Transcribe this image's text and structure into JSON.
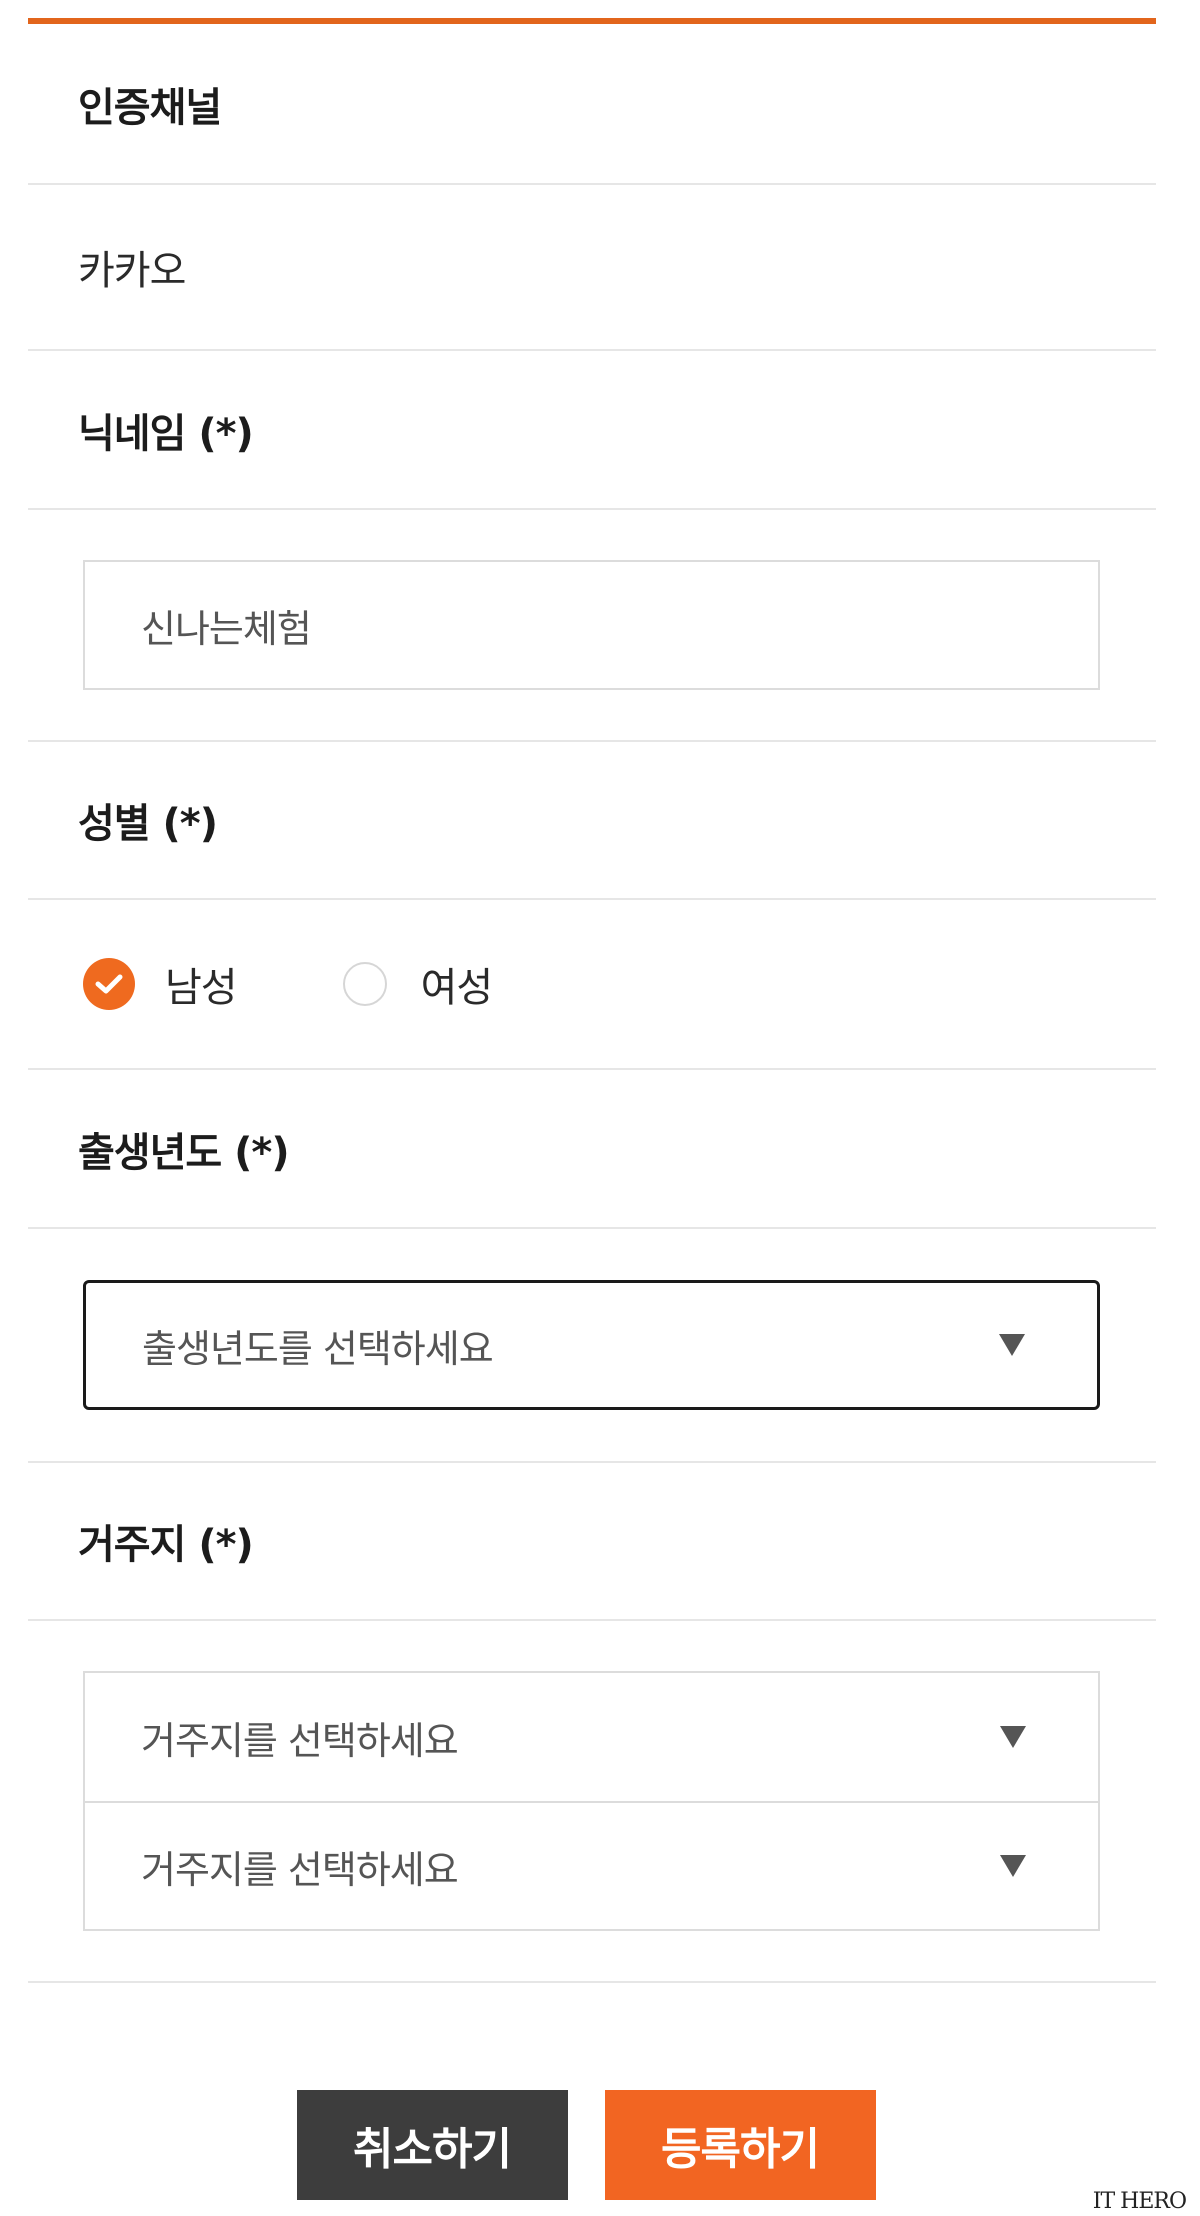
{
  "auth_channel": {
    "label": "인증채널",
    "value": "카카오"
  },
  "nickname": {
    "label": "닉네임 (*)",
    "value": "신나는체험"
  },
  "gender": {
    "label": "성별 (*)",
    "options": [
      {
        "label": "남성",
        "selected": true
      },
      {
        "label": "여성",
        "selected": false
      }
    ]
  },
  "birth_year": {
    "label": "출생년도 (*)",
    "placeholder": "출생년도를 선택하세요"
  },
  "residence": {
    "label": "거주지 (*)",
    "select1_placeholder": "거주지를 선택하세요",
    "select2_placeholder": "거주지를 선택하세요"
  },
  "buttons": {
    "cancel": "취소하기",
    "submit": "등록하기"
  },
  "watermark": "IT HERO",
  "colors": {
    "accent": "#f26522",
    "top_bar": "#e2651c",
    "cancel_bg": "#3d3d3d",
    "divider": "#e6e6e6"
  },
  "icons": {
    "checked_radio": "check-circle-icon",
    "unchecked_radio": "radio-empty-icon",
    "dropdown": "triangle-down-icon"
  }
}
